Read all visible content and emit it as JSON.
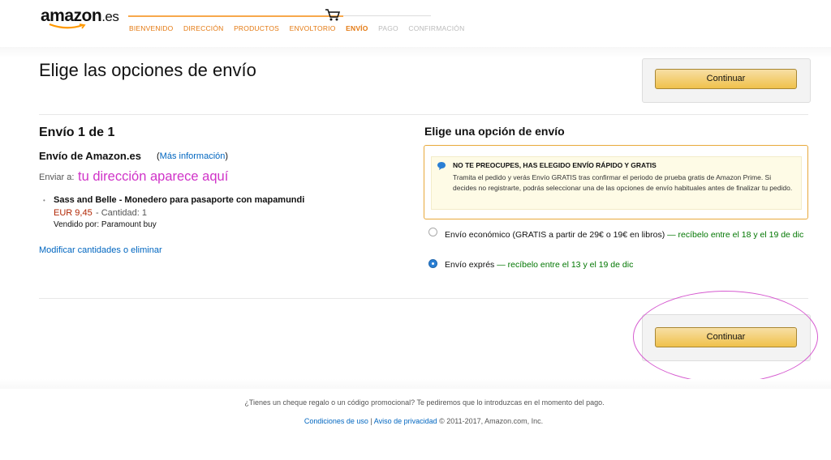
{
  "header": {
    "logo_main": "amazon",
    "logo_tld": ".es",
    "steps": [
      {
        "label": "BIENVENIDO",
        "state": "done"
      },
      {
        "label": "DIRECCIÓN",
        "state": "done"
      },
      {
        "label": "PRODUCTOS",
        "state": "done"
      },
      {
        "label": "ENVOLTORIO",
        "state": "done"
      },
      {
        "label": "ENVÍO",
        "state": "current"
      },
      {
        "label": "PAGO",
        "state": "future"
      },
      {
        "label": "CONFIRMACIÓN",
        "state": "future"
      }
    ]
  },
  "page_title": "Elige las opciones de envío",
  "continue_label": "Continuar",
  "shipment": {
    "number": "Envío 1 de 1",
    "from": "Envío de Amazon.es",
    "more_info_open": "(",
    "more_info": "Más información",
    "more_info_close": ")",
    "send_to_label": "Enviar a:",
    "send_to_value": "tu dirección aparece aquí",
    "item": {
      "title": "Sass and Belle - Monedero para pasaporte con mapamundi",
      "price": "EUR 9,45",
      "qty": "- Cantidad: 1",
      "seller": "Vendido por: Paramount buy"
    },
    "modify": "Modificar cantidades o eliminar"
  },
  "shipping_options": {
    "title": "Elige una opción de envío",
    "promo_head": "NO TE PREOCUPES, HAS ELEGIDO ENVÍO RÁPIDO Y GRATIS",
    "promo_body": "Tramita el pedido y verás Envío GRATIS tras confirmar el periodo de prueba gratis de Amazon Prime. Si decides no registrarte, podrás seleccionar una de las opciones de envío habituales antes de finalizar tu pedido.",
    "option1_text": "Envío económico (GRATIS a partir de 29€ o 19€ en libros)",
    "option1_eta": "— recíbelo entre el 18 y el 19 de dic",
    "option2_text": "Envío exprés",
    "option2_eta": "— recíbelo entre el 13 y el 19 de dic",
    "selected": 2
  },
  "footer": {
    "promo": "¿Tienes un cheque regalo o un código promocional? Te pediremos que lo introduzcas en el momento del pago.",
    "terms": "Condiciones de uso",
    "sep": " | ",
    "privacy": "Aviso de privacidad",
    "copyright": " © 2011-2017, Amazon.com, Inc."
  },
  "colors": {
    "accent": "#e47911",
    "link": "#0066c0",
    "green": "#007600",
    "price": "#b12704",
    "annotation": "#d033c8"
  }
}
